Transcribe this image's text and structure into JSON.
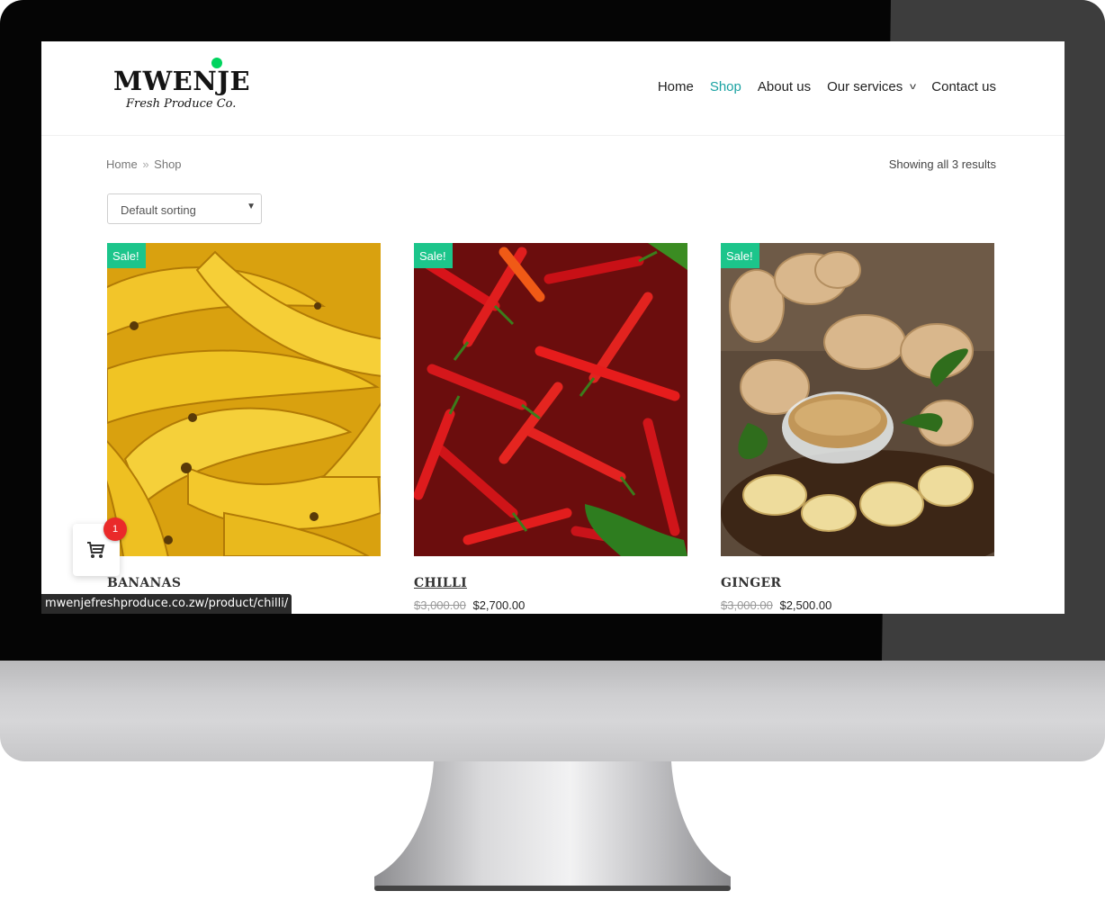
{
  "logo": {
    "name": "MWENJE",
    "tagline": "Fresh Produce Co."
  },
  "nav": {
    "items": [
      {
        "label": "Home"
      },
      {
        "label": "Shop",
        "active": true
      },
      {
        "label": "About us"
      },
      {
        "label": "Our services",
        "has_dropdown": true
      },
      {
        "label": "Contact us"
      }
    ]
  },
  "breadcrumb": {
    "home": "Home",
    "separator": "»",
    "current": "Shop"
  },
  "results": {
    "text": "Showing all 3 results"
  },
  "sort": {
    "selected": "Default sorting"
  },
  "products": [
    {
      "title": "BANANAS",
      "badge": "Sale!",
      "old_price": "",
      "price": ""
    },
    {
      "title": "CHILLI",
      "badge": "Sale!",
      "old_price": "$3,000.00",
      "price": "$2,700.00"
    },
    {
      "title": "GINGER",
      "badge": "Sale!",
      "old_price": "$3,000.00",
      "price": "$2,500.00"
    }
  ],
  "cart": {
    "count": "1",
    "icon": "cart-icon"
  },
  "status_bar": {
    "url": "mwenjefreshproduce.co.zw/product/chilli/"
  },
  "colors": {
    "accent": "#1aa2a2",
    "sale_badge": "#1cc58b",
    "cart_badge": "#ea2a2a",
    "logo_dot": "#00d45e"
  }
}
